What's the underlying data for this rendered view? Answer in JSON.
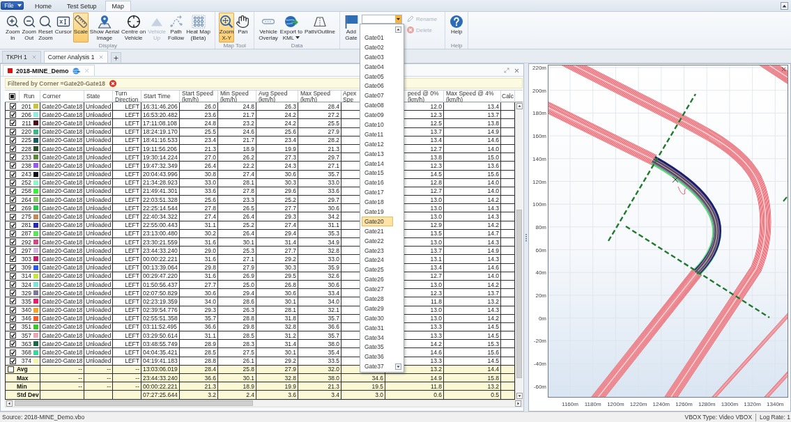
{
  "menu": {
    "file": "File",
    "tabs": [
      {
        "label": "Home",
        "selected": false
      },
      {
        "label": "Test Setup",
        "selected": false
      },
      {
        "label": "Map",
        "selected": true
      }
    ]
  },
  "ribbon": {
    "groups": [
      {
        "label": "Display",
        "buttons": [
          {
            "kind": "zoomin",
            "label": "Zoom\nIn",
            "selected": false,
            "disabled": false
          },
          {
            "kind": "zoomout",
            "label": "Zoom\nOut",
            "selected": false,
            "disabled": false
          },
          {
            "kind": "reset",
            "label": "Reset\nZoom",
            "selected": false,
            "disabled": false
          },
          {
            "kind": "cursor",
            "label": "Cursor",
            "selected": false,
            "disabled": false
          },
          {
            "kind": "scale",
            "label": "Scale",
            "selected": true,
            "disabled": false
          },
          {
            "kind": "aerial",
            "label": "Show Aerial\nImage",
            "selected": false,
            "disabled": false
          },
          {
            "kind": "centre",
            "label": "Centre on\nVehicle",
            "selected": false,
            "disabled": false
          },
          {
            "kind": "vehicleup",
            "label": "Vehicle\nUp",
            "selected": false,
            "disabled": true
          },
          {
            "kind": "pathfollow",
            "label": "Path\nFollow",
            "selected": false,
            "disabled": false
          },
          {
            "kind": "heatmap",
            "label": "Heat Map\n(Beta)",
            "selected": false,
            "disabled": false
          }
        ]
      },
      {
        "label": "Map Tool",
        "buttons": [
          {
            "kind": "zoomxy",
            "label": "Zoom\nX-Y",
            "selected": true,
            "disabled": false
          },
          {
            "kind": "pan",
            "label": "Pan",
            "selected": false,
            "disabled": false
          }
        ]
      },
      {
        "label": "Data",
        "buttons": [
          {
            "kind": "overlay",
            "label": "Vehicle\nOverlay",
            "selected": false,
            "disabled": false
          },
          {
            "kind": "export",
            "label": "Export to\nKML",
            "dropdown": true,
            "selected": false,
            "disabled": false
          },
          {
            "kind": "outline",
            "label": "Path/Outline",
            "selected": false,
            "disabled": false
          }
        ]
      },
      {
        "buttons": [
          {
            "kind": "flag",
            "label": "Add\nGate",
            "selected": false,
            "disabled": false
          }
        ],
        "gate_selector": {
          "expanded": true,
          "options": [
            {
              "label": "Gate01",
              "selected": false
            },
            {
              "label": "Gate02",
              "selected": false
            },
            {
              "label": "Gate03",
              "selected": false
            },
            {
              "label": "Gate04",
              "selected": false
            },
            {
              "label": "Gate05",
              "selected": false
            },
            {
              "label": "Gate06",
              "selected": false
            },
            {
              "label": "Gate07",
              "selected": false
            },
            {
              "label": "Gate08",
              "selected": false
            },
            {
              "label": "Gate09",
              "selected": false
            },
            {
              "label": "Gate10",
              "selected": false
            },
            {
              "label": "Gate11",
              "selected": false
            },
            {
              "label": "Gate12",
              "selected": false
            },
            {
              "label": "Gate13",
              "selected": false
            },
            {
              "label": "Gate14",
              "selected": false
            },
            {
              "label": "Gate15",
              "selected": false
            },
            {
              "label": "Gate16",
              "selected": false
            },
            {
              "label": "Gate17",
              "selected": false
            },
            {
              "label": "Gate18",
              "selected": false
            },
            {
              "label": "Gate19",
              "selected": false
            },
            {
              "label": "Gate20",
              "selected": true
            },
            {
              "label": "Gate21",
              "selected": false
            },
            {
              "label": "Gate22",
              "selected": false
            },
            {
              "label": "Gate23",
              "selected": false
            },
            {
              "label": "Gate24",
              "selected": false
            },
            {
              "label": "Gate25",
              "selected": false
            },
            {
              "label": "Gate26",
              "selected": false
            },
            {
              "label": "Gate27",
              "selected": false
            },
            {
              "label": "Gate28",
              "selected": false
            },
            {
              "label": "Gate29",
              "selected": false
            },
            {
              "label": "Gate30",
              "selected": false
            },
            {
              "label": "Gate31",
              "selected": false
            },
            {
              "label": "Gate34",
              "selected": false
            },
            {
              "label": "Gate35",
              "selected": false
            },
            {
              "label": "Gate36",
              "selected": false
            },
            {
              "label": "Gate37",
              "selected": false
            }
          ]
        },
        "actions": [
          {
            "kind": "rename",
            "label": "Rename",
            "disabled": true
          },
          {
            "kind": "delete",
            "label": "Delete",
            "disabled": true
          }
        ]
      },
      {
        "label": "Help",
        "buttons": [
          {
            "kind": "help",
            "label": "Help",
            "selected": false,
            "disabled": false
          }
        ]
      }
    ]
  },
  "doc_tabs": [
    {
      "label": "TKPH 1",
      "selected": false
    },
    {
      "label": "Corner Analysis 1",
      "selected": true
    }
  ],
  "panel": {
    "tab": "2018-MINE_Demo",
    "filter": "Filtered by Corner =Gate20-Gate18"
  },
  "table": {
    "select_all": {
      "checked": true
    },
    "columns": [
      "Run",
      "Corner",
      "State",
      "Turn Direction",
      "Start Time",
      "Start Speed (km/h)",
      "Min Speed (km/h)",
      "Avg Speed (km/h)",
      "Max Speed (km/h)",
      "Apex Spe",
      "peed @ 0% (km/h)",
      "Max Speed @ 4% (km/h)",
      "Calc"
    ],
    "rows": [
      {
        "checked": true,
        "run": "201",
        "color": "#c8c43a",
        "corner": "Gate20-Gate18",
        "state": "Unloaded",
        "turn": "LEFT",
        "start_time": "16:31:46.206",
        "start_speed": "26.0",
        "min_speed": "24.8",
        "avg_speed": "26.3",
        "max_speed": "28.4",
        "speed_0": "12.0",
        "speed_4": "13.4"
      },
      {
        "checked": true,
        "run": "206",
        "color": "#8ef0e0",
        "corner": "Gate20-Gate18",
        "state": "Unloaded",
        "turn": "LEFT",
        "start_time": "16:53:20.482",
        "start_speed": "23.6",
        "min_speed": "21.7",
        "avg_speed": "24.2",
        "max_speed": "27.2",
        "speed_0": "12.3",
        "speed_4": "13.7"
      },
      {
        "checked": true,
        "run": "211",
        "color": "#4a0a1a",
        "corner": "Gate20-Gate18",
        "state": "Unloaded",
        "turn": "LEFT",
        "start_time": "17:11:08.108",
        "start_speed": "24.8",
        "min_speed": "23.2",
        "avg_speed": "24.2",
        "max_speed": "25.5",
        "speed_0": "12.5",
        "speed_4": "13.8"
      },
      {
        "checked": true,
        "run": "220",
        "color": "#3ab88a",
        "corner": "Gate20-Gate18",
        "state": "Unloaded",
        "turn": "LEFT",
        "start_time": "18:24:19.170",
        "start_speed": "25.5",
        "min_speed": "24.6",
        "avg_speed": "25.6",
        "max_speed": "27.9",
        "speed_0": "13.7",
        "speed_4": "14.9"
      },
      {
        "checked": true,
        "run": "225",
        "color": "#1a5a5a",
        "corner": "Gate20-Gate18",
        "state": "Unloaded",
        "turn": "LEFT",
        "start_time": "18:41:16.533",
        "start_speed": "23.4",
        "min_speed": "21.7",
        "avg_speed": "23.4",
        "max_speed": "28.2",
        "speed_0": "13.4",
        "speed_4": "14.6"
      },
      {
        "checked": true,
        "run": "228",
        "color": "#2f4f2f",
        "corner": "Gate20-Gate18",
        "state": "Unloaded",
        "turn": "LEFT",
        "start_time": "19:11:56.206",
        "start_speed": "21.3",
        "min_speed": "18.9",
        "avg_speed": "19.9",
        "max_speed": "21.3",
        "speed_0": "12.7",
        "speed_4": "14.0"
      },
      {
        "checked": true,
        "run": "233",
        "color": "#5a8a3a",
        "corner": "Gate20-Gate18",
        "state": "Unloaded",
        "turn": "LEFT",
        "start_time": "19:30:14.224",
        "start_speed": "27.0",
        "min_speed": "26.2",
        "avg_speed": "27.3",
        "max_speed": "29.7",
        "speed_0": "13.8",
        "speed_4": "15.0"
      },
      {
        "checked": true,
        "run": "238",
        "color": "#9a5af0",
        "corner": "Gate20-Gate18",
        "state": "Unloaded",
        "turn": "LEFT",
        "start_time": "19:47:32.349",
        "start_speed": "26.4",
        "min_speed": "22.2",
        "avg_speed": "24.3",
        "max_speed": "27.1",
        "speed_0": "12.3",
        "speed_4": "13.6"
      },
      {
        "checked": true,
        "run": "243",
        "color": "#10101a",
        "corner": "Gate20-Gate18",
        "state": "Unloaded",
        "turn": "LEFT",
        "start_time": "20:04:43.996",
        "start_speed": "30.8",
        "min_speed": "27.4",
        "avg_speed": "30.6",
        "max_speed": "35.7",
        "speed_0": "14.5",
        "speed_4": "15.6"
      },
      {
        "checked": true,
        "run": "252",
        "color": "#8ef5c8",
        "corner": "Gate20-Gate18",
        "state": "Unloaded",
        "turn": "LEFT",
        "start_time": "21:34:28.923",
        "start_speed": "33.0",
        "min_speed": "28.1",
        "avg_speed": "30.3",
        "max_speed": "33.0",
        "speed_0": "12.8",
        "speed_4": "14.0"
      },
      {
        "checked": true,
        "run": "258",
        "color": "#3af03a",
        "corner": "Gate20-Gate18",
        "state": "Unloaded",
        "turn": "LEFT",
        "start_time": "21:49:41.301",
        "start_speed": "33.6",
        "min_speed": "27.8",
        "avg_speed": "29.6",
        "max_speed": "33.6",
        "speed_0": "12.7",
        "speed_4": "14.0"
      },
      {
        "checked": true,
        "run": "264",
        "color": "#8ac86a",
        "corner": "Gate20-Gate18",
        "state": "Unloaded",
        "turn": "LEFT",
        "start_time": "22:03:51.328",
        "start_speed": "25.6",
        "min_speed": "23.3",
        "avg_speed": "25.2",
        "max_speed": "29.7",
        "speed_0": "13.0",
        "speed_4": "14.2"
      },
      {
        "checked": true,
        "run": "269",
        "color": "#2ac84a",
        "corner": "Gate20-Gate18",
        "state": "Unloaded",
        "turn": "LEFT",
        "start_time": "22:25:14.544",
        "start_speed": "27.8",
        "min_speed": "26.5",
        "avg_speed": "27.7",
        "max_speed": "30.6",
        "speed_0": "13.0",
        "speed_4": "14.3"
      },
      {
        "checked": true,
        "run": "275",
        "color": "#c08a5a",
        "corner": "Gate20-Gate18",
        "state": "Unloaded",
        "turn": "LEFT",
        "start_time": "22:40:34.322",
        "start_speed": "27.4",
        "min_speed": "26.4",
        "avg_speed": "29.3",
        "max_speed": "34.2",
        "speed_0": "13.0",
        "speed_4": "14.3"
      },
      {
        "checked": true,
        "run": "281",
        "color": "#2a2ab0",
        "corner": "Gate20-Gate18",
        "state": "Unloaded",
        "turn": "LEFT",
        "start_time": "22:55:00.443",
        "start_speed": "31.1",
        "min_speed": "25.2",
        "avg_speed": "27.4",
        "max_speed": "31.1",
        "speed_0": "12.9",
        "speed_4": "14.2"
      },
      {
        "checked": true,
        "run": "287",
        "color": "#5ae85a",
        "corner": "Gate20-Gate18",
        "state": "Unloaded",
        "turn": "LEFT",
        "start_time": "23:13:00.480",
        "start_speed": "30.2",
        "min_speed": "26.4",
        "avg_speed": "29.4",
        "max_speed": "35.3",
        "speed_0": "13.5",
        "speed_4": "14.7"
      },
      {
        "checked": true,
        "run": "292",
        "color": "#d04a8a",
        "corner": "Gate20-Gate18",
        "state": "Unloaded",
        "turn": "LEFT",
        "start_time": "23:30:21.559",
        "start_speed": "31.6",
        "min_speed": "30.1",
        "avg_speed": "31.4",
        "max_speed": "34.9",
        "speed_0": "13.0",
        "speed_4": "14.3"
      },
      {
        "checked": true,
        "run": "297",
        "color": "#d4b8e0",
        "corner": "Gate20-Gate18",
        "state": "Unloaded",
        "turn": "LEFT",
        "start_time": "23:44:33.240",
        "start_speed": "29.0",
        "min_speed": "25.3",
        "avg_speed": "27.7",
        "max_speed": "32.8",
        "speed_0": "13.7",
        "speed_4": "14.9"
      },
      {
        "checked": true,
        "run": "303",
        "color": "#c0206a",
        "corner": "Gate20-Gate18",
        "state": "Unloaded",
        "turn": "LEFT",
        "start_time": "00:00:22.221",
        "start_speed": "31.6",
        "min_speed": "27.1",
        "avg_speed": "29.2",
        "max_speed": "33.0",
        "speed_0": "13.1",
        "speed_4": "14.3"
      },
      {
        "checked": true,
        "run": "309",
        "color": "#2a5af0",
        "corner": "Gate20-Gate18",
        "state": "Unloaded",
        "turn": "LEFT",
        "start_time": "00:13:39.064",
        "start_speed": "29.8",
        "min_speed": "27.9",
        "avg_speed": "30.3",
        "max_speed": "35.9",
        "speed_0": "13.4",
        "speed_4": "14.6"
      },
      {
        "checked": true,
        "run": "314",
        "color": "#c4e83a",
        "corner": "Gate20-Gate18",
        "state": "Unloaded",
        "turn": "LEFT",
        "start_time": "00:29:47.220",
        "start_speed": "31.6",
        "min_speed": "26.9",
        "avg_speed": "29.5",
        "max_speed": "32.6",
        "speed_0": "12.7",
        "speed_4": "14.0"
      },
      {
        "checked": true,
        "run": "324",
        "color": "#7ae8d8",
        "corner": "Gate20-Gate18",
        "state": "Unloaded",
        "turn": "LEFT",
        "start_time": "01:50:56.437",
        "start_speed": "27.7",
        "min_speed": "25.0",
        "avg_speed": "26.8",
        "max_speed": "30.6",
        "speed_0": "13.0",
        "speed_4": "14.2"
      },
      {
        "checked": true,
        "run": "329",
        "color": "#7a7a9a",
        "corner": "Gate20-Gate18",
        "state": "Unloaded",
        "turn": "LEFT",
        "start_time": "02:07:50.829",
        "start_speed": "30.6",
        "min_speed": "29.4",
        "avg_speed": "30.6",
        "max_speed": "33.4",
        "speed_0": "12.3",
        "speed_4": "13.7"
      },
      {
        "checked": true,
        "run": "335",
        "color": "#e8206a",
        "corner": "Gate20-Gate18",
        "state": "Unloaded",
        "turn": "LEFT",
        "start_time": "02:23:19.359",
        "start_speed": "34.0",
        "min_speed": "28.6",
        "avg_speed": "30.1",
        "max_speed": "34.0",
        "speed_0": "11.8",
        "speed_4": "13.2"
      },
      {
        "checked": true,
        "run": "340",
        "color": "#f5a62a",
        "corner": "Gate20-Gate18",
        "state": "Unloaded",
        "turn": "LEFT",
        "start_time": "02:39:54.776",
        "start_speed": "29.3",
        "min_speed": "26.3",
        "avg_speed": "28.1",
        "max_speed": "32.1",
        "speed_0": "13.0",
        "speed_4": "14.3"
      },
      {
        "checked": true,
        "run": "346",
        "color": "#f5602a",
        "corner": "Gate20-Gate18",
        "state": "Unloaded",
        "turn": "LEFT",
        "start_time": "02:55:51.358",
        "start_speed": "35.7",
        "min_speed": "28.8",
        "avg_speed": "31.8",
        "max_speed": "35.7",
        "speed_0": "13.0",
        "speed_4": "14.2"
      },
      {
        "checked": true,
        "run": "351",
        "color": "#3ac82a",
        "corner": "Gate20-Gate18",
        "state": "Unloaded",
        "turn": "LEFT",
        "start_time": "03:11:52.495",
        "start_speed": "36.6",
        "min_speed": "29.8",
        "avg_speed": "32.8",
        "max_speed": "36.6",
        "speed_0": "13.3",
        "speed_4": "14.5"
      },
      {
        "checked": true,
        "run": "357",
        "color": "#e8a8b8",
        "corner": "Gate20-Gate18",
        "state": "Unloaded",
        "turn": "LEFT",
        "start_time": "03:29:50.614",
        "start_speed": "31.1",
        "min_speed": "28.5",
        "avg_speed": "31.2",
        "max_speed": "35.7",
        "speed_0": "13.3",
        "speed_4": "14.5"
      },
      {
        "checked": true,
        "run": "363",
        "color": "#1a6a4a",
        "corner": "Gate20-Gate18",
        "state": "Unloaded",
        "turn": "LEFT",
        "start_time": "03:48:55.749",
        "start_speed": "28.9",
        "min_speed": "28.3",
        "avg_speed": "31.4",
        "max_speed": "38.0",
        "speed_0": "14.2",
        "speed_4": "15.3"
      },
      {
        "checked": true,
        "run": "368",
        "color": "#3ad89a",
        "corner": "Gate20-Gate18",
        "state": "Unloaded",
        "turn": "LEFT",
        "start_time": "04:04:35.421",
        "start_speed": "28.5",
        "min_speed": "27.5",
        "avg_speed": "30.1",
        "max_speed": "35.4",
        "speed_0": "14.6",
        "speed_4": "15.6"
      },
      {
        "checked": true,
        "run": "374",
        "color": "#f5f5a8",
        "corner": "Gate20-Gate18",
        "state": "Unloaded",
        "turn": "LEFT",
        "start_time": "04:19:41.183",
        "start_speed": "28.8",
        "min_speed": "26.1",
        "avg_speed": "29.2",
        "max_speed": "33.5",
        "speed_0": "13.3",
        "speed_4": "14.5"
      }
    ],
    "summary": [
      {
        "label": "Avg",
        "checked": false,
        "corner": "--",
        "state": "--",
        "turn": "--",
        "start_time": "13:03:06.019",
        "start_speed": "28.4",
        "min_speed": "25.8",
        "avg_speed": "27.9",
        "max_speed": "32.0",
        "speed_0": "13.2",
        "speed_4": "14.4"
      },
      {
        "label": "Max",
        "corner": "--",
        "state": "--",
        "turn": "--",
        "start_time": "23:44:33.240",
        "start_speed": "36.6",
        "min_speed": "30.1",
        "avg_speed": "32.8",
        "max_speed": "38.0",
        "apex_speed": "34.6",
        "speed_0": "14.9",
        "speed_4": "15.8"
      },
      {
        "label": "Min",
        "corner": "--",
        "state": "--",
        "turn": "--",
        "start_time": "00:00:22.221",
        "start_speed": "21.3",
        "min_speed": "18.9",
        "avg_speed": "19.9",
        "max_speed": "21.3",
        "apex_speed": "19.5",
        "speed_0": "11.8",
        "speed_4": "13.2"
      },
      {
        "label": "Std Dev",
        "start_time": "07:27:25.644",
        "start_speed": "3.2",
        "min_speed": "2.4",
        "avg_speed": "3.6",
        "max_speed": "3.4",
        "apex_speed": "3.0",
        "speed_0": "0.6",
        "speed_4": "0.5"
      }
    ]
  },
  "map": {
    "y_axis_labels": [
      "220m",
      "200m",
      "180m",
      "160m",
      "140m",
      "120m",
      "100m",
      "80m",
      "60m",
      "40m",
      "20m",
      "0m",
      "-20m",
      "-40m",
      "-60m"
    ],
    "x_axis_labels": [
      "1160m",
      "1180m",
      "1200m",
      "1220m",
      "1240m",
      "1260m",
      "1280m",
      "1300m",
      "1320m",
      "1340m"
    ]
  },
  "status_bar": {
    "source": "Source: 2018-MINE_Demo.vbo",
    "vbox_type": "VBOX Type: Video VBOX",
    "log_rate": "Log Rate: 1"
  }
}
